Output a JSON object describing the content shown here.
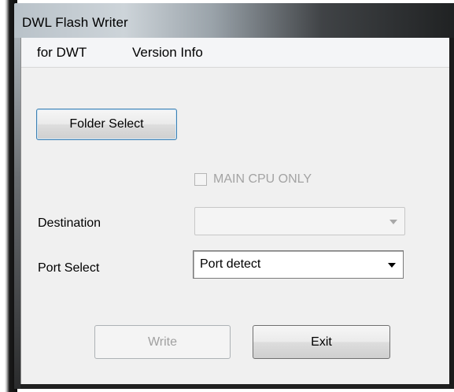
{
  "window": {
    "title": "DWL Flash Writer"
  },
  "menu": {
    "items": [
      "for DWT",
      "Version Info"
    ]
  },
  "form": {
    "folder_select_label": "Folder Select",
    "main_cpu_only_label": "MAIN CPU ONLY",
    "main_cpu_only_checked": false,
    "main_cpu_only_enabled": false,
    "destination_label": "Destination",
    "destination_value": "",
    "destination_enabled": false,
    "port_select_label": "Port Select",
    "port_select_value": "Port detect"
  },
  "actions": {
    "write_label": "Write",
    "write_enabled": false,
    "exit_label": "Exit"
  },
  "icons": {
    "combo_arrow": "chevron-down-icon"
  }
}
